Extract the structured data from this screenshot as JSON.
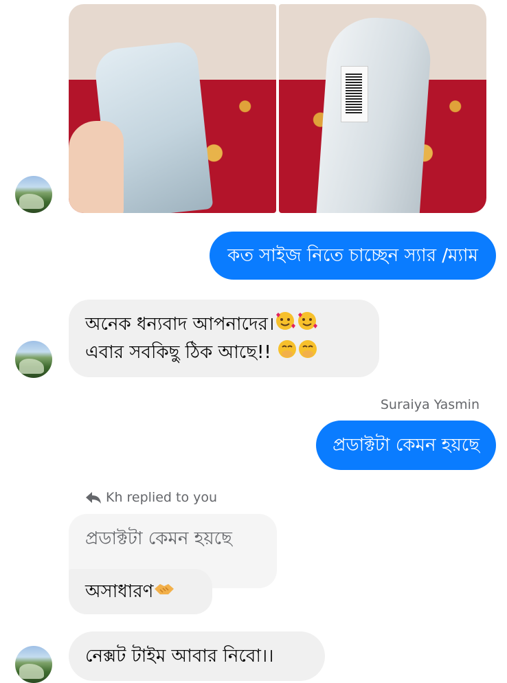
{
  "messages": {
    "m1": "কত সাইজ নিতে চাচ্ছেন স্যার /ম্যাম",
    "m2_line1": "অনেক ধন্যবাদ আপনাদের।",
    "m2_line2": "এবার সবকিছু ঠিক আছে!! ",
    "m3": "প্রডাক্টটা কেমন হয়ছে",
    "reply_quote": "প্রডাক্টটা কেমন হয়ছে",
    "m4": "অসাধারণ ",
    "m5": "নেক্সট টাইম আবার নিবো।।"
  },
  "sender_name": "Suraiya Yasmin",
  "reply_note": "Kh replied to you",
  "colors": {
    "outgoing": "#0a7cff",
    "incoming": "#f0f0f0",
    "meta_text": "#65676b"
  },
  "icons": {
    "reply": "reply-arrow-icon",
    "heart_face": "smiling-face-with-hearts-icon",
    "giggle": "face-with-hand-over-mouth-icon",
    "handshake": "handshake-icon"
  }
}
